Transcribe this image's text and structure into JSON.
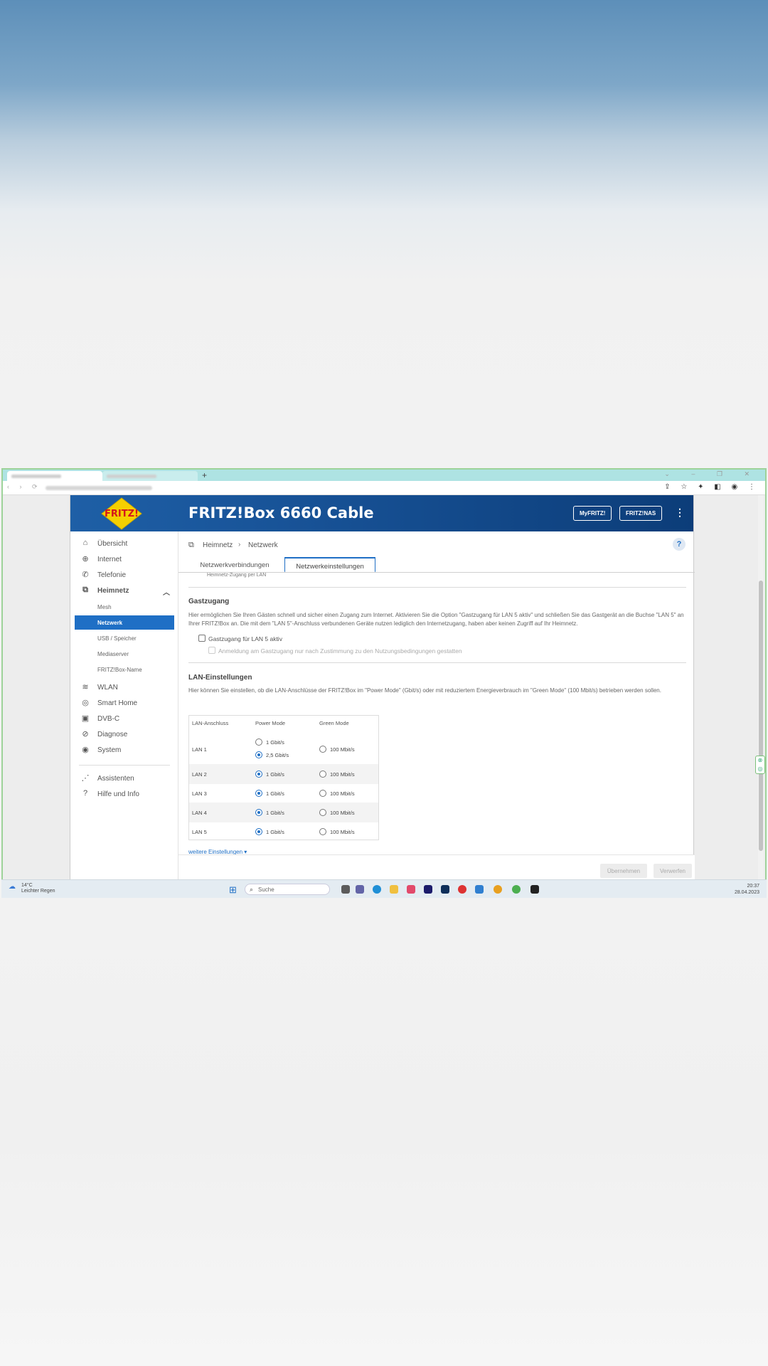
{
  "browser": {
    "new_tab": "+",
    "window_controls": "⌄ – ❐ ✕",
    "nav_buttons": "‹ › ⟳",
    "toolbar_icons": "⇪ ☆ ✦ ◧ ◉ ⋮"
  },
  "header": {
    "logo_text": "FRITZ!",
    "product": "FRITZ!Box 6660 Cable",
    "myfritz": "MyFRITZ!",
    "fritznas": "FRITZ!NAS",
    "menu": "⋮"
  },
  "sidebar": {
    "items": [
      {
        "label": "Übersicht",
        "icon": "home-icon",
        "glyph": "⌂"
      },
      {
        "label": "Internet",
        "icon": "globe-icon",
        "glyph": "⊕"
      },
      {
        "label": "Telefonie",
        "icon": "phone-icon",
        "glyph": "✆"
      },
      {
        "label": "Heimnetz",
        "icon": "network-icon",
        "glyph": "⧉"
      },
      {
        "label": "WLAN",
        "icon": "wifi-icon",
        "glyph": "≋"
      },
      {
        "label": "Smart Home",
        "icon": "camera-icon",
        "glyph": "◎"
      },
      {
        "label": "DVB-C",
        "icon": "tv-icon",
        "glyph": "▣"
      },
      {
        "label": "Diagnose",
        "icon": "diagnose-icon",
        "glyph": "⊘"
      },
      {
        "label": "System",
        "icon": "system-icon",
        "glyph": "◉"
      },
      {
        "label": "Assistenten",
        "icon": "assistant-icon",
        "glyph": "⋰"
      },
      {
        "label": "Hilfe und Info",
        "icon": "help-icon",
        "glyph": "?"
      }
    ],
    "subitems": [
      "Mesh",
      "Netzwerk",
      "USB / Speicher",
      "Mediaserver",
      "FRITZ!Box-Name"
    ],
    "expand_glyph": "︿"
  },
  "breadcrumb": {
    "icon": "⧉",
    "level1": "Heimnetz",
    "sep": "›",
    "level2": "Netzwerk"
  },
  "help_button": "?",
  "tabs": [
    "Netzwerkverbindungen",
    "Netzwerkeinstellungen"
  ],
  "content": {
    "cut_label": "Heimnetz-Zugang per LAN",
    "guest": {
      "title": "Gastzugang",
      "text": "Hier ermöglichen Sie Ihren Gästen schnell und sicher einen Zugang zum Internet. Aktivieren Sie die Option \"Gastzugang für LAN 5 aktiv\" und schließen Sie das Gastgerät an die Buchse \"LAN 5\" an Ihrer FRITZ!Box an. Die mit dem \"LAN 5\"-Anschluss verbundenen Geräte nutzen lediglich den Internetzugang, haben aber keinen Zugriff auf Ihr Heimnetz.",
      "checkbox1": "Gastzugang für LAN 5 aktiv",
      "checkbox2": "Anmeldung am Gastzugang nur nach Zustimmung zu den Nutzungsbedingungen gestatten"
    },
    "lan": {
      "title": "LAN-Einstellungen",
      "text": "Hier können Sie einstellen, ob die LAN-Anschlüsse der FRITZ!Box im \"Power Mode\" (Gbit/s) oder mit reduziertem Energieverbrauch im \"Green Mode\" (100 Mbit/s) betrieben werden sollen.",
      "headers": [
        "LAN-Anschluss",
        "Power Mode",
        "Green Mode"
      ],
      "rows": [
        {
          "port": "LAN 1",
          "power": [
            "1 Gbit/s",
            "2,5 Gbit/s"
          ],
          "power_selected": 1,
          "green": "100 Mbit/s",
          "green_selected": false
        },
        {
          "port": "LAN 2",
          "power": [
            "1 Gbit/s"
          ],
          "power_selected": 0,
          "green": "100 Mbit/s",
          "green_selected": false
        },
        {
          "port": "LAN 3",
          "power": [
            "1 Gbit/s"
          ],
          "power_selected": 0,
          "green": "100 Mbit/s",
          "green_selected": false
        },
        {
          "port": "LAN 4",
          "power": [
            "1 Gbit/s"
          ],
          "power_selected": 0,
          "green": "100 Mbit/s",
          "green_selected": false
        },
        {
          "port": "LAN 5",
          "power": [
            "1 Gbit/s"
          ],
          "power_selected": 0,
          "green": "100 Mbit/s",
          "green_selected": false
        }
      ]
    },
    "more_settings": "weitere Einstellungen ▾"
  },
  "footer": {
    "apply": "Übernehmen",
    "discard": "Verwerfen"
  },
  "taskbar": {
    "temp": "14°C",
    "weather": "Leichter Regen",
    "search": "Suche",
    "time": "20:37",
    "date": "28.04.2023"
  },
  "colors": {
    "accent": "#1f6fc5",
    "header_dark": "#0c3d79"
  }
}
